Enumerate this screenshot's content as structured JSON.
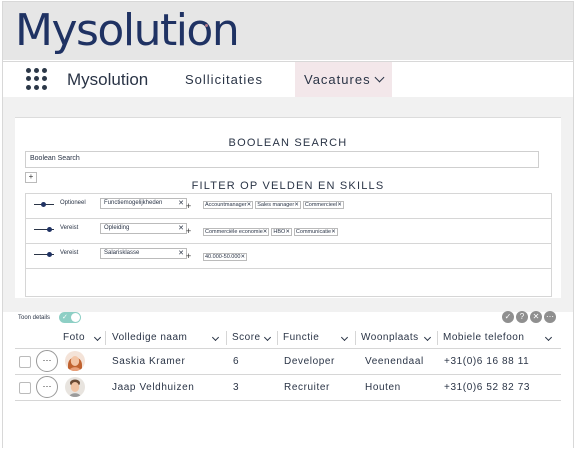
{
  "brand": {
    "logo_text": "Mysolution",
    "name": "Mysolution"
  },
  "nav": {
    "items": [
      {
        "label": "Sollicitaties"
      },
      {
        "label": "Vacatures"
      }
    ]
  },
  "boolean_search": {
    "title": "BOOLEAN SEARCH",
    "input_value": "Boolean Search",
    "add_label": "+"
  },
  "filter": {
    "title": "FILTER OP VELDEN EN SKILLS",
    "rows": [
      {
        "mode": "Optioneel",
        "field": "Functiemogelijkheden",
        "chips": [
          "Accountmanager",
          "Sales manager",
          "Commercieel"
        ]
      },
      {
        "mode": "Vereist",
        "field": "Opleiding",
        "chips": [
          "Commerciële economie",
          "HBO",
          "Communicatie"
        ]
      },
      {
        "mode": "Vereist",
        "field": "Salarisklasse",
        "chips": [
          "40.000-50.000"
        ]
      }
    ]
  },
  "toolbar": {
    "toggle_label": "Toon details",
    "toggle_on": true
  },
  "table": {
    "columns": [
      "Foto",
      "Volledige naam",
      "Score",
      "Functie",
      "Woonplaats",
      "Mobiele telefoon"
    ],
    "rows": [
      {
        "name": "Saskia Kramer",
        "score": "6",
        "function": "Developer",
        "city": "Veenendaal",
        "phone": "+31(0)6 16 88 11"
      },
      {
        "name": "Jaap Veldhuizen",
        "score": "3",
        "function": "Recruiter",
        "city": "Houten",
        "phone": "+31(0)6 52 82 73"
      }
    ]
  },
  "colors": {
    "brand": "#1f3263",
    "toggle": "#8ecfc5",
    "nav_active_bg": "#f3e7ea",
    "panel_bg": "#f1f1f1"
  }
}
